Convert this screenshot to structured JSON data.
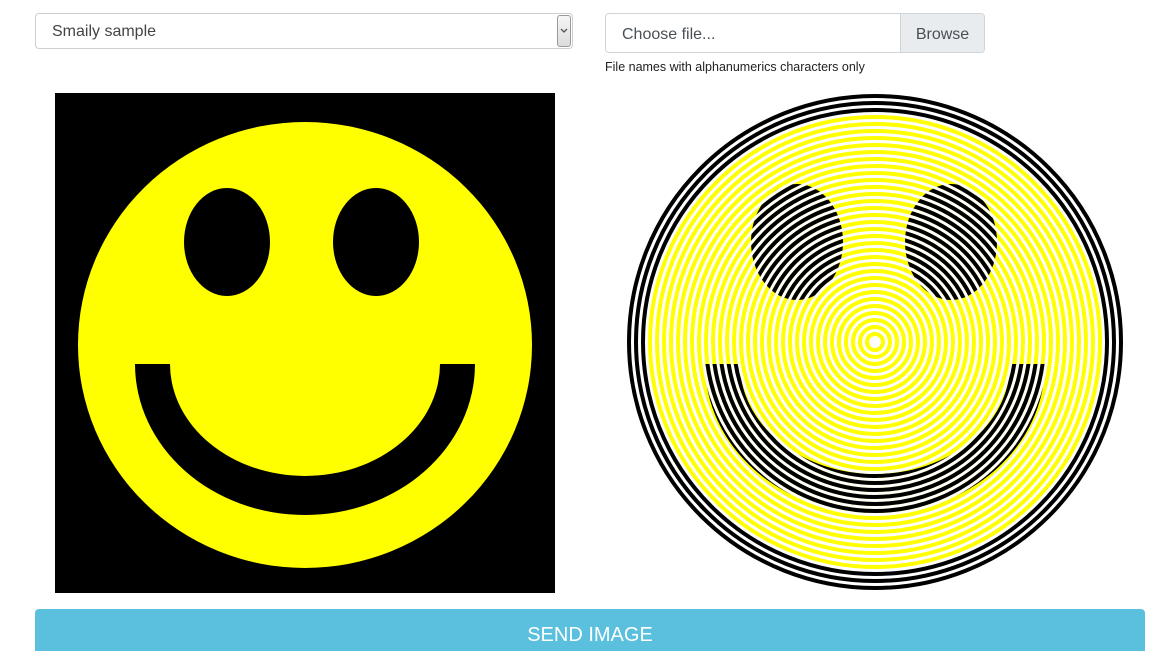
{
  "sample_select": {
    "selected": "Smaily sample"
  },
  "file_input": {
    "placeholder": "Choose file...",
    "browse_label": "Browse",
    "hint": "File names with alphanumerics characters only"
  },
  "colors": {
    "smiley_yellow": "#ffff00",
    "background_black": "#000000",
    "button_blue": "#5bc0de"
  },
  "send_button": {
    "label": "SEND IMAGE"
  },
  "images": {
    "original": "smiley-original-image",
    "converted": "smiley-spiral-image"
  }
}
